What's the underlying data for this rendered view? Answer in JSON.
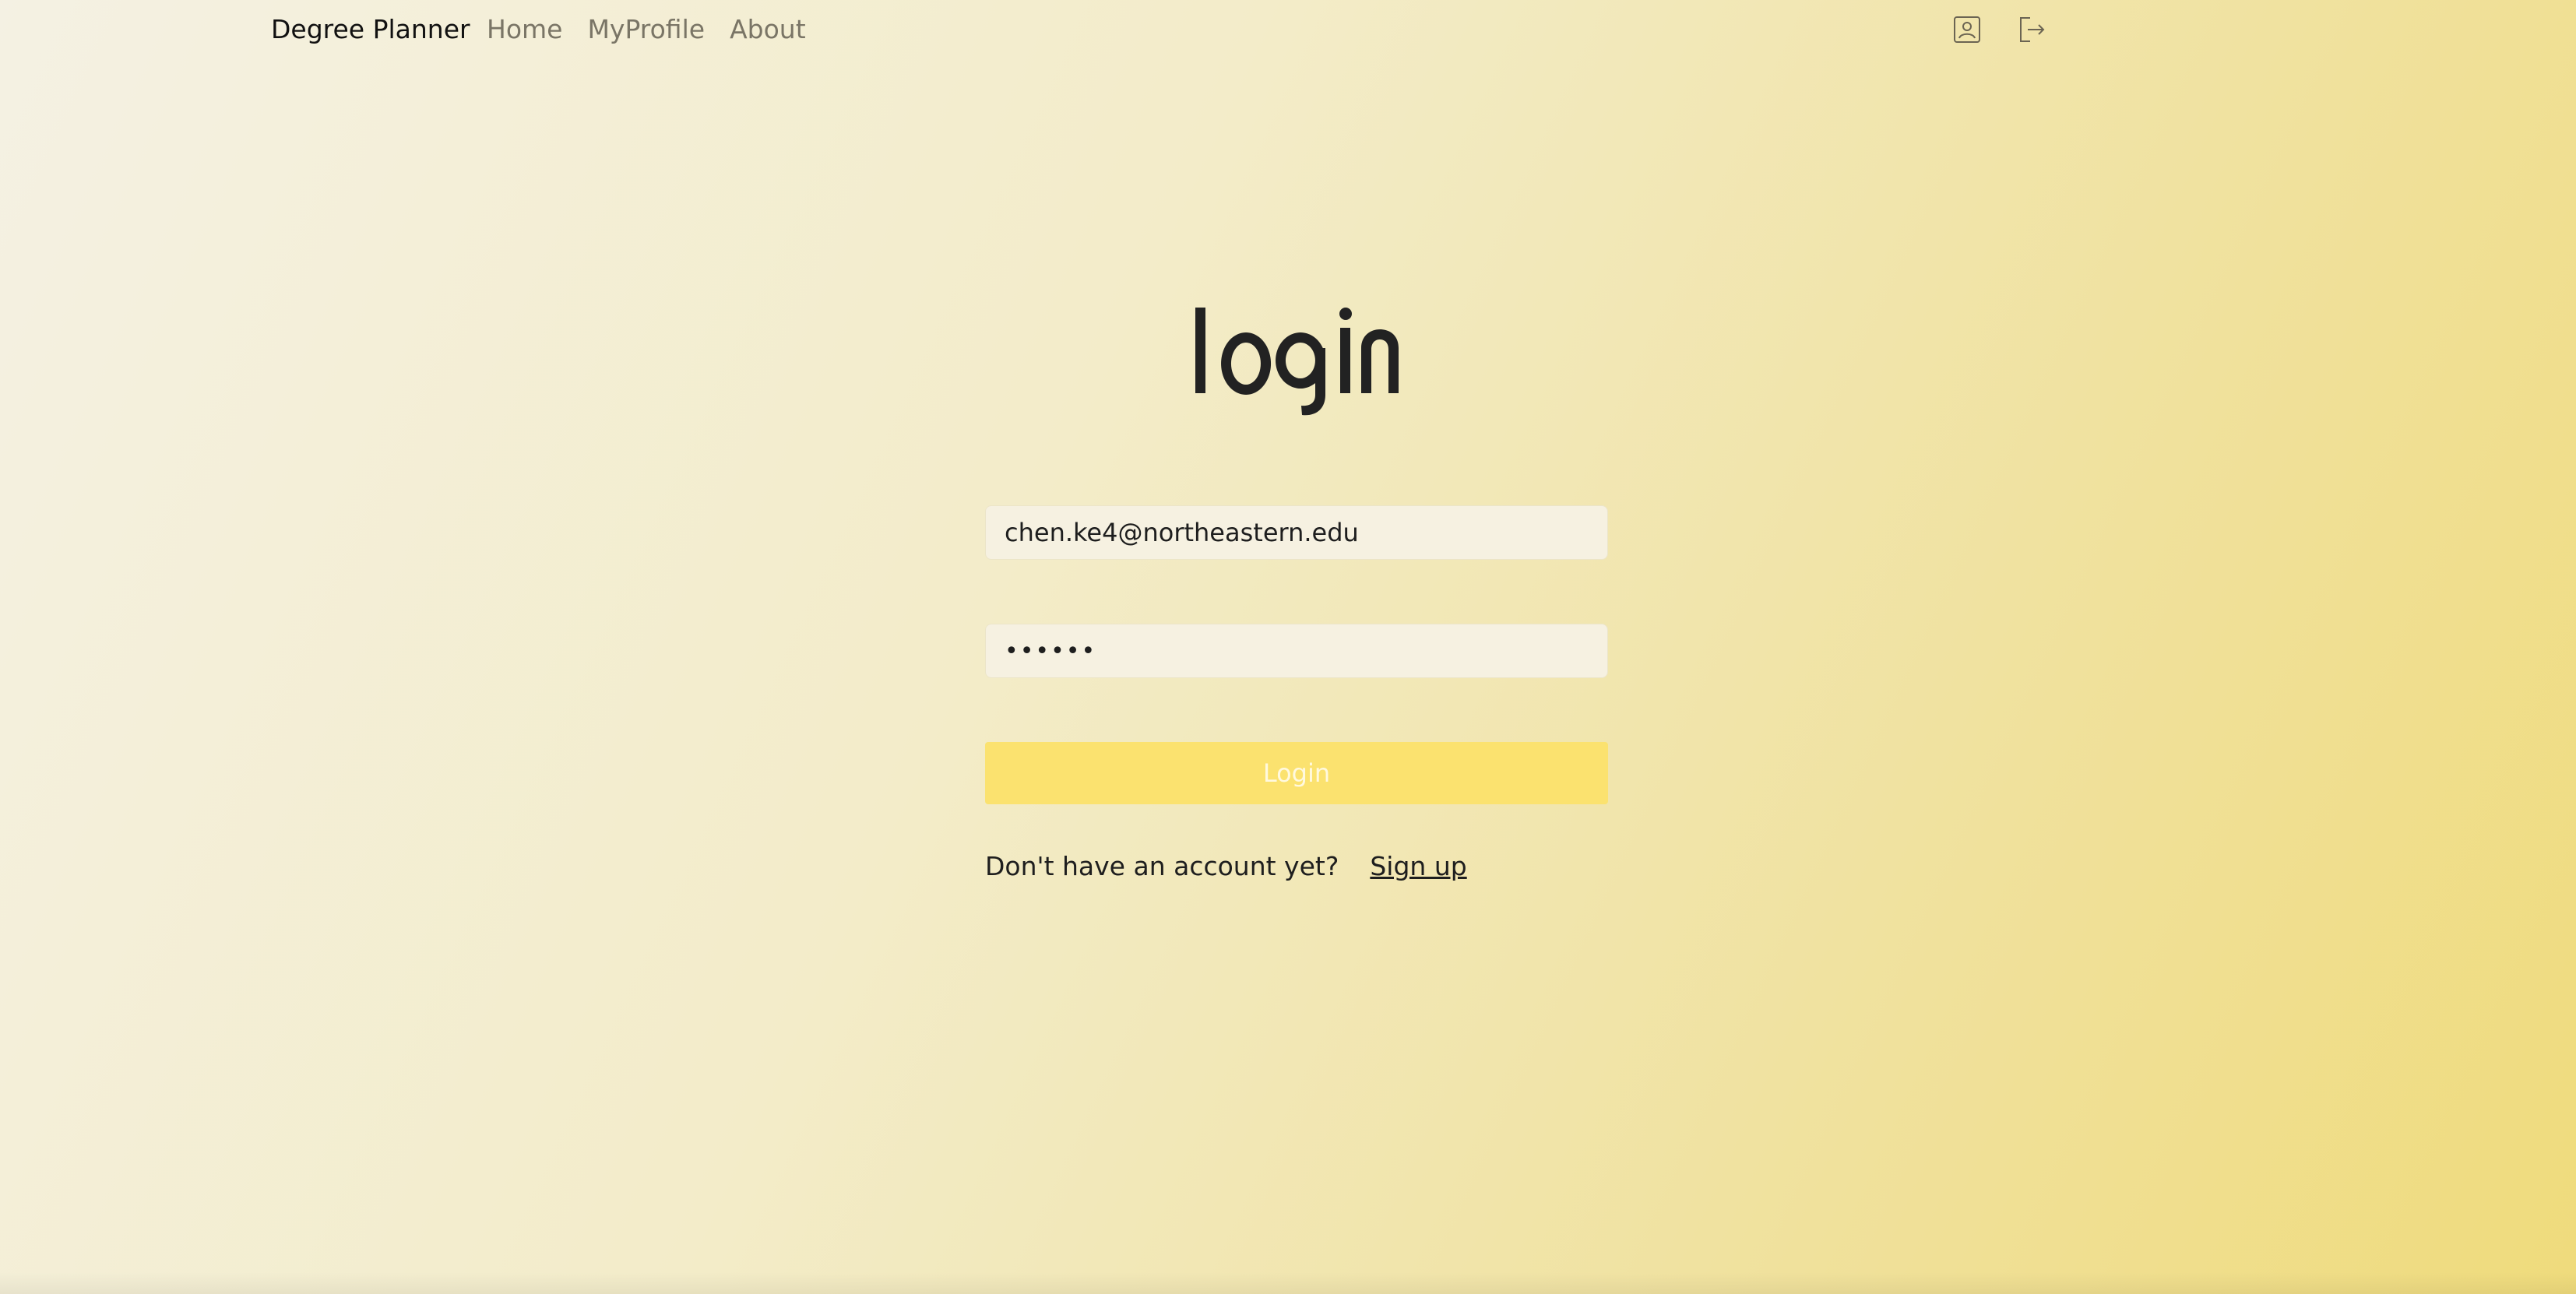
{
  "navbar": {
    "brand": "Degree Planner",
    "links": [
      {
        "label": "Home"
      },
      {
        "label": "MyProfile"
      },
      {
        "label": "About"
      }
    ],
    "icons": [
      "profile-icon",
      "logout-icon"
    ]
  },
  "logo": {
    "text": "login"
  },
  "form": {
    "email_value": "chen.ke4@northeastern.edu",
    "password_value": "••••••",
    "login_label": "Login"
  },
  "signup": {
    "prompt": "Don't have an account yet?",
    "link_label": "Sign up"
  },
  "colors": {
    "accent_button": "#fbe26f",
    "background_start": "#f4f1e3",
    "background_end": "#efdb7c",
    "nav_link": "#7a7566"
  }
}
